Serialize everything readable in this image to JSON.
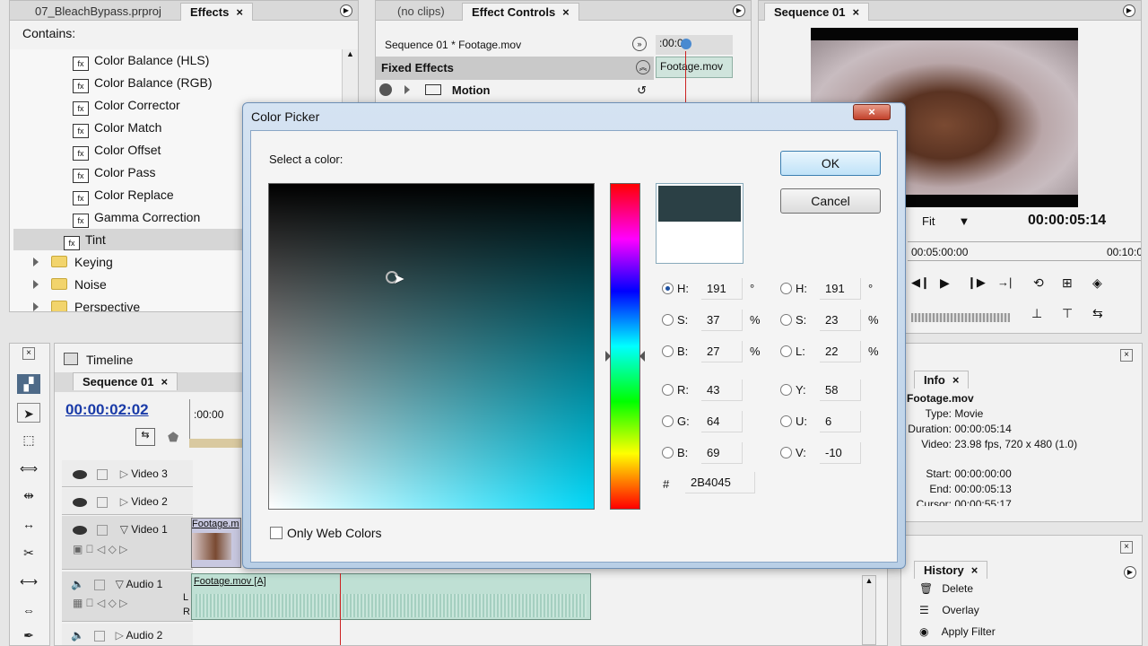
{
  "project_panel": {
    "tab_project": "07_BleachBypass.prproj",
    "tab_effects": "Effects",
    "contains_label": "Contains:",
    "effects": [
      "Color Balance (HLS)",
      "Color Balance (RGB)",
      "Color Corrector",
      "Color Match",
      "Color Offset",
      "Color Pass",
      "Color Replace",
      "Gamma Correction",
      "Tint"
    ],
    "folders": [
      "Keying",
      "Noise",
      "Perspective"
    ]
  },
  "effect_controls": {
    "tab_noclips": "(no clips)",
    "tab_label": "Effect Controls",
    "sequence_label": "Sequence 01 * Footage.mov",
    "timecode": ":00:00",
    "clip_label": "Footage.mov",
    "fixed_effects": "Fixed Effects",
    "motion": "Motion"
  },
  "program_monitor": {
    "tab": "Sequence 01",
    "fit": "Fit",
    "timecode": "00:00:05:14",
    "ruler_left": "00:05:00:00",
    "ruler_right": "00:10:0"
  },
  "timeline": {
    "title": "Timeline",
    "tab": "Sequence 01",
    "timecode": "00:00:02:02",
    "ruler_start": ":00:00",
    "tracks": [
      "Video 3",
      "Video 2",
      "Video 1",
      "Audio 1",
      "Audio 2"
    ],
    "video_clip": "Footage.m",
    "audio_clip": "Footage.mov  [A]",
    "audio_l": "L",
    "audio_r": "R"
  },
  "info_panel": {
    "tab": "Info",
    "filename": "Footage.mov",
    "type_label": "Type:",
    "type_value": "Movie",
    "duration_label": "Duration:",
    "duration_value": "00:00:05:14",
    "video_label": "Video:",
    "video_value": "23.98 fps, 720 x 480 (1.0)",
    "start_label": "Start:",
    "start_value": "00:00:00:00",
    "end_label": "End:",
    "end_value": "00:00:05:13",
    "cursor_label": "Cursor:",
    "cursor_value": "00:00:55:17"
  },
  "history_panel": {
    "tab": "History",
    "items": [
      "Delete",
      "Overlay",
      "Apply Filter"
    ]
  },
  "color_picker": {
    "title": "Color Picker",
    "select_label": "Select a color:",
    "ok": "OK",
    "cancel": "Cancel",
    "only_web": "Only Web Colors",
    "hash": "#",
    "hex": "2B4045",
    "selected_color": "#2b4045",
    "hue_color": "#00d8f8",
    "left_fields": [
      {
        "label": "H:",
        "value": "191",
        "unit": "°",
        "on": true
      },
      {
        "label": "S:",
        "value": "37",
        "unit": "%",
        "on": false
      },
      {
        "label": "B:",
        "value": "27",
        "unit": "%",
        "on": false
      },
      {
        "label": "R:",
        "value": "43",
        "unit": "",
        "on": false
      },
      {
        "label": "G:",
        "value": "64",
        "unit": "",
        "on": false
      },
      {
        "label": "B:",
        "value": "69",
        "unit": "",
        "on": false
      }
    ],
    "right_fields": [
      {
        "label": "H:",
        "value": "191",
        "unit": "°"
      },
      {
        "label": "S:",
        "value": "23",
        "unit": "%"
      },
      {
        "label": "L:",
        "value": "22",
        "unit": "%"
      },
      {
        "label": "Y:",
        "value": "58",
        "unit": ""
      },
      {
        "label": "U:",
        "value": "6",
        "unit": ""
      },
      {
        "label": "V:",
        "value": "-10",
        "unit": ""
      }
    ]
  }
}
